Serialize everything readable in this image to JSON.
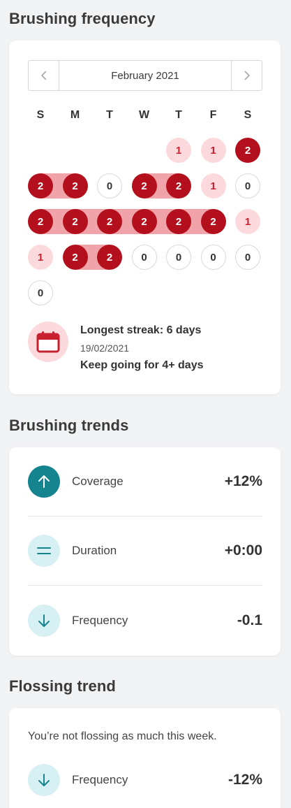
{
  "brushing_frequency": {
    "title": "Brushing frequency",
    "month": "February 2021",
    "prev_icon": "chevron-left-icon",
    "next_icon": "chevron-right-icon",
    "weekdays": [
      "S",
      "M",
      "T",
      "W",
      "T",
      "F",
      "S"
    ],
    "days": [
      {
        "week": 0,
        "dow": 4,
        "value": "1"
      },
      {
        "week": 0,
        "dow": 5,
        "value": "1"
      },
      {
        "week": 0,
        "dow": 6,
        "value": "2"
      },
      {
        "week": 1,
        "dow": 0,
        "value": "2"
      },
      {
        "week": 1,
        "dow": 1,
        "value": "2"
      },
      {
        "week": 1,
        "dow": 2,
        "value": "0"
      },
      {
        "week": 1,
        "dow": 3,
        "value": "2"
      },
      {
        "week": 1,
        "dow": 4,
        "value": "2"
      },
      {
        "week": 1,
        "dow": 5,
        "value": "1"
      },
      {
        "week": 1,
        "dow": 6,
        "value": "0"
      },
      {
        "week": 2,
        "dow": 0,
        "value": "2"
      },
      {
        "week": 2,
        "dow": 1,
        "value": "2"
      },
      {
        "week": 2,
        "dow": 2,
        "value": "2"
      },
      {
        "week": 2,
        "dow": 3,
        "value": "2"
      },
      {
        "week": 2,
        "dow": 4,
        "value": "2"
      },
      {
        "week": 2,
        "dow": 5,
        "value": "2"
      },
      {
        "week": 2,
        "dow": 6,
        "value": "1"
      },
      {
        "week": 3,
        "dow": 0,
        "value": "1"
      },
      {
        "week": 3,
        "dow": 1,
        "value": "2"
      },
      {
        "week": 3,
        "dow": 2,
        "value": "2"
      },
      {
        "week": 3,
        "dow": 3,
        "value": "0"
      },
      {
        "week": 3,
        "dow": 4,
        "value": "0"
      },
      {
        "week": 3,
        "dow": 5,
        "value": "0"
      },
      {
        "week": 3,
        "dow": 6,
        "value": "0"
      },
      {
        "week": 4,
        "dow": 0,
        "value": "0"
      }
    ],
    "streak": {
      "icon": "calendar-icon",
      "title": "Longest streak: 6 days",
      "date": "19/02/2021",
      "keep_going": "Keep going for 4+ days"
    }
  },
  "brushing_trends": {
    "title": "Brushing trends",
    "rows": [
      {
        "label": "Coverage",
        "value": "+12%",
        "icon": "arrow-up-icon"
      },
      {
        "label": "Duration",
        "value": "+0:00",
        "icon": "equals-icon"
      },
      {
        "label": "Frequency",
        "value": "-0.1",
        "icon": "arrow-down-icon"
      }
    ]
  },
  "flossing_trend": {
    "title": "Flossing trend",
    "message": "You’re not flossing as much this week.",
    "rows": [
      {
        "label": "Frequency",
        "value": "-12%",
        "icon": "arrow-down-icon"
      }
    ]
  },
  "colors": {
    "two_brushes": "#b30f1c",
    "one_brush": "#fbd9dc",
    "streak_band": "#f0a4a9",
    "teal": "#15848f",
    "teal_light": "#d6f0f3"
  }
}
